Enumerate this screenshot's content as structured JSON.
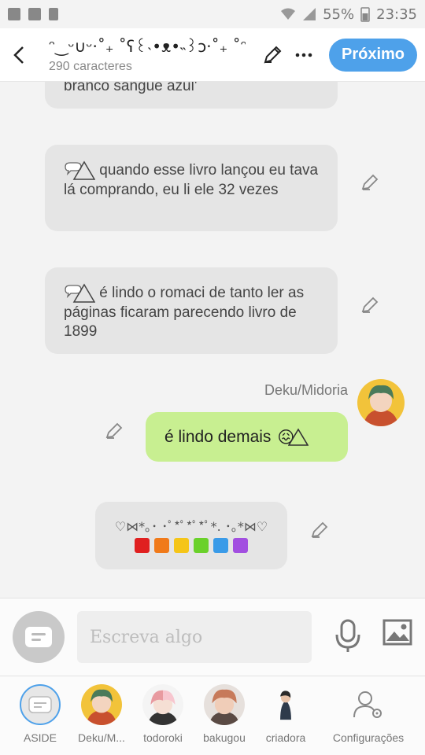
{
  "status_bar": {
    "battery": "55%",
    "time": "23:35"
  },
  "header": {
    "title": "ᵔ‿ᵕ∪ᵕ·˚₊ ˚ʕ꒰˴•ᴥ•˵꒱ɔ·˚₊ ˚ᵔ...",
    "subtitle": "290 caracteres",
    "next_label": "Próximo"
  },
  "messages": [
    {
      "text": "branco sangue azul'"
    },
    {
      "emoji": "💭",
      "text": " quando esse livro lançou eu tava lá comprando, eu li ele 32 vezes"
    },
    {
      "emoji": "💭",
      "text": " é lindo o romaci de tanto ler as páginas ficaram parecendo livro de 1899"
    },
    {
      "sender": "Deku/Midoria",
      "text": "é lindo demais",
      "emoji": "😖"
    },
    {
      "line1": "♡⋈*｡･ ･ﾟ*ﾟ*ﾟ*ﾟ*. ･｡*⋈♡",
      "line2": "🟥🟧🟨🟩🟦🟪"
    }
  ],
  "compose": {
    "placeholder": "Escreva algo"
  },
  "tabs": [
    {
      "label": "ASIDE"
    },
    {
      "label": "Deku/M..."
    },
    {
      "label": "todoroki"
    },
    {
      "label": "bakugou"
    },
    {
      "label": "criadora"
    },
    {
      "label": "Configurações"
    }
  ],
  "colors": {
    "accent": "#4ea1ea",
    "my_bubble": "#c8ef91",
    "bubble": "#e5e5e5"
  }
}
